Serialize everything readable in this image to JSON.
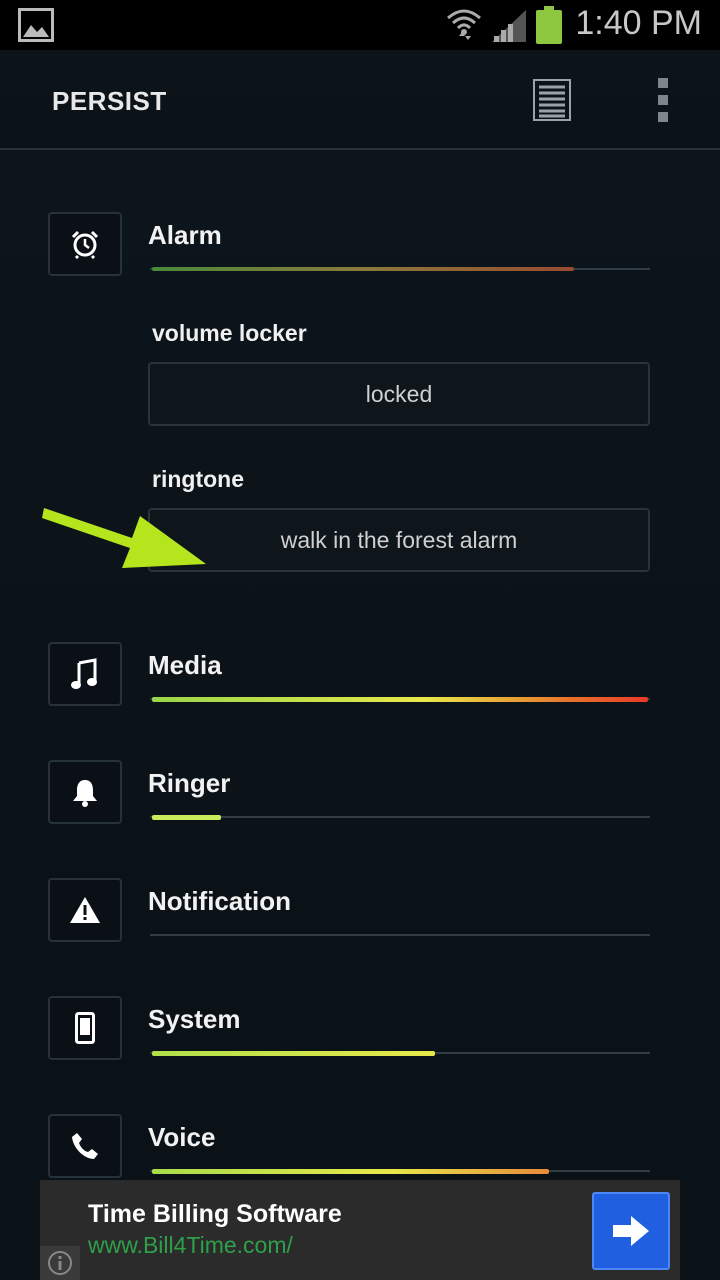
{
  "status_bar": {
    "time": "1:40 PM",
    "battery_color": "#8dc63f"
  },
  "action_bar": {
    "title": "PERSIST"
  },
  "streams": [
    {
      "key": "alarm",
      "label": "Alarm",
      "level": 0.85,
      "icon": "alarm-clock-icon"
    },
    {
      "key": "media",
      "label": "Media",
      "level": 1.0,
      "icon": "music-note-icon"
    },
    {
      "key": "ringer",
      "label": "Ringer",
      "level": 0.14,
      "icon": "bell-icon"
    },
    {
      "key": "notification",
      "label": "Notification",
      "level": 0.0,
      "icon": "warning-icon"
    },
    {
      "key": "system",
      "label": "System",
      "level": 0.57,
      "icon": "phone-icon"
    },
    {
      "key": "voice",
      "label": "Voice",
      "level": 0.8,
      "icon": "handset-icon"
    }
  ],
  "alarm_options": {
    "volume_locker_label": "volume locker",
    "volume_locker_value": "locked",
    "ringtone_label": "ringtone",
    "ringtone_value": "walk in the forest alarm"
  },
  "ad": {
    "title": "Time Billing Software",
    "url": "www.Bill4Time.com/"
  },
  "colors": {
    "accent_green": "#b5e61d",
    "level_gradient_start": "#9ad64a",
    "level_gradient_mid": "#e8e84a",
    "level_gradient_end": "#e83a2a"
  }
}
